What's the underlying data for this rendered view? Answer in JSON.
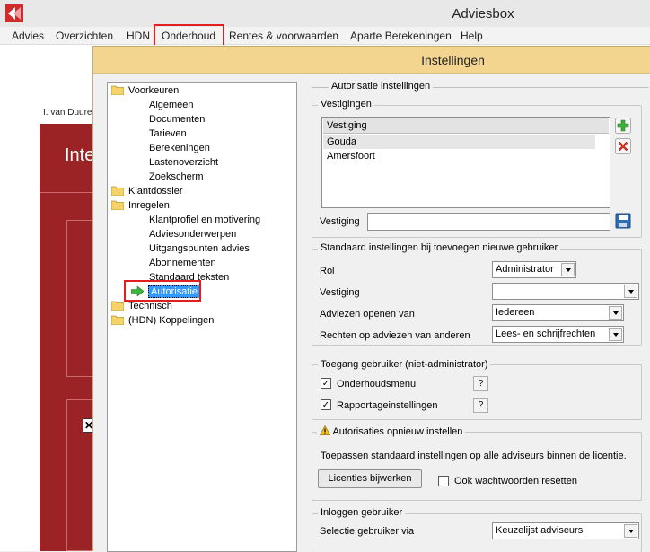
{
  "app": {
    "title": "Adviesbox",
    "menu": [
      "Advies",
      "Overzichten",
      "HDN",
      "Onderhoud",
      "Rentes & voorwaarden",
      "Aparte Berekeningen",
      "Help"
    ],
    "user_name": "I. van Duure",
    "red_title": "Inte"
  },
  "dialog": {
    "title": "Instellingen",
    "tree": [
      {
        "label": "Voorkeuren",
        "type": "folder"
      },
      {
        "label": "Algemeen",
        "type": "leaf"
      },
      {
        "label": "Documenten",
        "type": "leaf"
      },
      {
        "label": "Tarieven",
        "type": "leaf"
      },
      {
        "label": "Berekeningen",
        "type": "leaf"
      },
      {
        "label": "Lastenoverzicht",
        "type": "leaf"
      },
      {
        "label": "Zoekscherm",
        "type": "leaf"
      },
      {
        "label": "Klantdossier",
        "type": "folder"
      },
      {
        "label": "Inregelen",
        "type": "folder"
      },
      {
        "label": "Klantprofiel en motivering",
        "type": "leaf"
      },
      {
        "label": "Adviesonderwerpen",
        "type": "leaf"
      },
      {
        "label": "Uitgangspunten advies",
        "type": "leaf"
      },
      {
        "label": "Abonnementen",
        "type": "leaf"
      },
      {
        "label": "Standaard teksten",
        "type": "leaf"
      },
      {
        "label": "Autorisatie",
        "type": "selected"
      },
      {
        "label": "Technisch",
        "type": "folder"
      },
      {
        "label": "(HDN) Koppelingen",
        "type": "folder"
      }
    ],
    "section_title": "Autorisatie instellingen",
    "vestigingen": {
      "group_title": "Vestigingen",
      "column": "Vestiging",
      "rows": [
        "Gouda",
        "Amersfoort"
      ],
      "field_label": "Vestiging",
      "field_value": ""
    },
    "standaard": {
      "group_title": "Standaard instellingen bij toevoegen nieuwe gebruiker",
      "rol_label": "Rol",
      "rol_value": "Administrator",
      "vestiging_label": "Vestiging",
      "vestiging_value": "",
      "adviezen_label": "Adviezen openen van",
      "adviezen_value": "Iedereen",
      "rechten_label": "Rechten op adviezen van anderen",
      "rechten_value": "Lees- en schrijfrechten"
    },
    "toegang": {
      "group_title": "Toegang gebruiker (niet-administrator)",
      "items": [
        {
          "label": "Onderhoudsmenu",
          "checked": true
        },
        {
          "label": "Rapportageinstellingen",
          "checked": true
        }
      ],
      "help": "?"
    },
    "opnieuw": {
      "group_title": "Autorisaties opnieuw instellen",
      "description": "Toepassen standaard instellingen op alle adviseurs binnen de licentie.",
      "button": "Licenties bijwerken",
      "checkbox_label": "Ook wachtwoorden resetten",
      "checked": false
    },
    "inloggen": {
      "group_title": "Inloggen gebruiker",
      "label": "Selectie gebruiker via",
      "value": "Keuzelijst adviseurs"
    }
  },
  "colors": {
    "brand_red": "#9b2325",
    "title_bar": "#f3d590",
    "selection": "#3399ff",
    "annotation": "#e02020"
  }
}
